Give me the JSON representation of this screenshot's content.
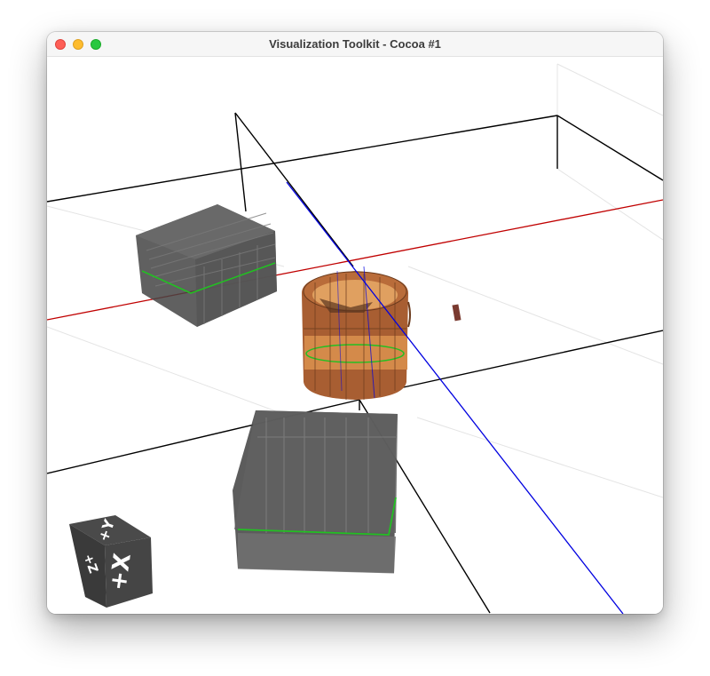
{
  "window": {
    "title": "Visualization Toolkit - Cocoa #1"
  },
  "orientation_cube": {
    "face_front_label": "+X",
    "face_top_label": "+Y",
    "face_side_label": "+Z"
  },
  "colors": {
    "x_axis": "#c00000",
    "y_axis": "#0000e0",
    "outline": "#000000",
    "intersection": "#00b000",
    "barrel": "#c8743c",
    "box_fill": "#555555",
    "cube": "#3a3a3a"
  },
  "icons": {
    "close": "close-window-icon",
    "minimize": "minimize-window-icon",
    "maximize": "maximize-window-icon"
  }
}
